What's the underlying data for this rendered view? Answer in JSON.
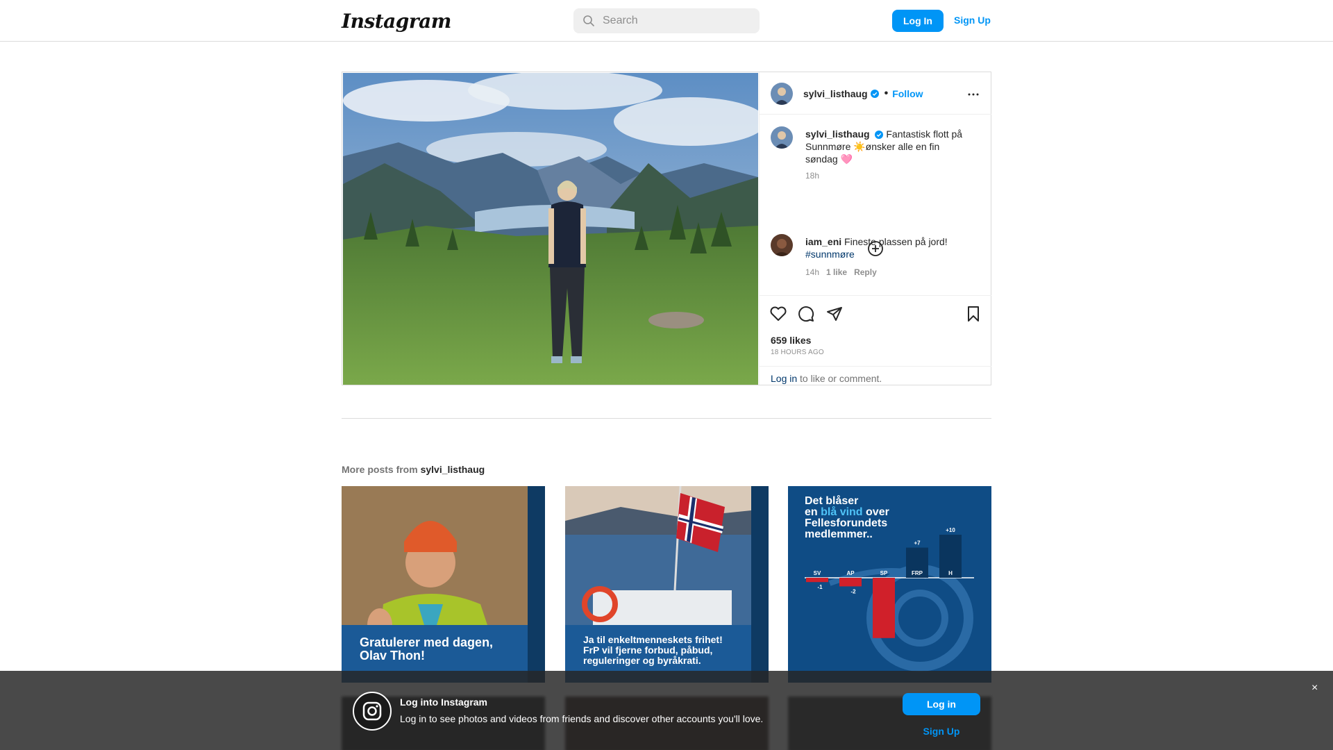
{
  "nav": {
    "logo": "Instagram",
    "search_placeholder": "Search",
    "login": "Log In",
    "signup": "Sign Up"
  },
  "post": {
    "author": "sylvi_listhaug",
    "follow": "Follow",
    "separator": "•",
    "caption": "Fantastisk flott på Sunnmøre ☀️ønsker alle en fin søndag 🩷",
    "caption_time": "18h",
    "comment": {
      "author": "iam_eni",
      "text": "Fineste plassen på jord!",
      "hashtag": "#sunnmøre",
      "time": "14h",
      "likes": "1 like",
      "reply": "Reply"
    },
    "likes": "659 likes",
    "posted_ago": "18 HOURS AGO",
    "login_link": "Log in",
    "login_rest": " to like or comment."
  },
  "more": {
    "prefix": "More posts from ",
    "user": "sylvi_listhaug",
    "thumbs": [
      {
        "caption": "Gratulerer med dagen,\nOlav Thon!"
      },
      {
        "caption": "Ja til enkeltmenneskets frihet!\nFrP vil fjerne forbud, påbud,\nreguleringer og byråkrati."
      },
      {
        "title_part1": "Det blåser",
        "title_part2a": "en ",
        "title_highlight": "blå vind",
        "title_part2b": " over",
        "title_part3": "Fellesforundets",
        "title_part4": "medlemmer..",
        "chart_data": {
          "type": "bar",
          "categories": [
            "SV",
            "AP",
            "SP",
            "FRP",
            "H"
          ],
          "values": [
            -1,
            -2,
            -14,
            7,
            10
          ],
          "data_labels": [
            "-1",
            "-2",
            "",
            "+7",
            "+10"
          ]
        }
      }
    ]
  },
  "banner": {
    "title": "Log into Instagram",
    "desc": "Log in to see photos and videos from friends and discover other accounts you'll love.",
    "login": "Log in",
    "signup": "Sign Up",
    "close": "×"
  }
}
